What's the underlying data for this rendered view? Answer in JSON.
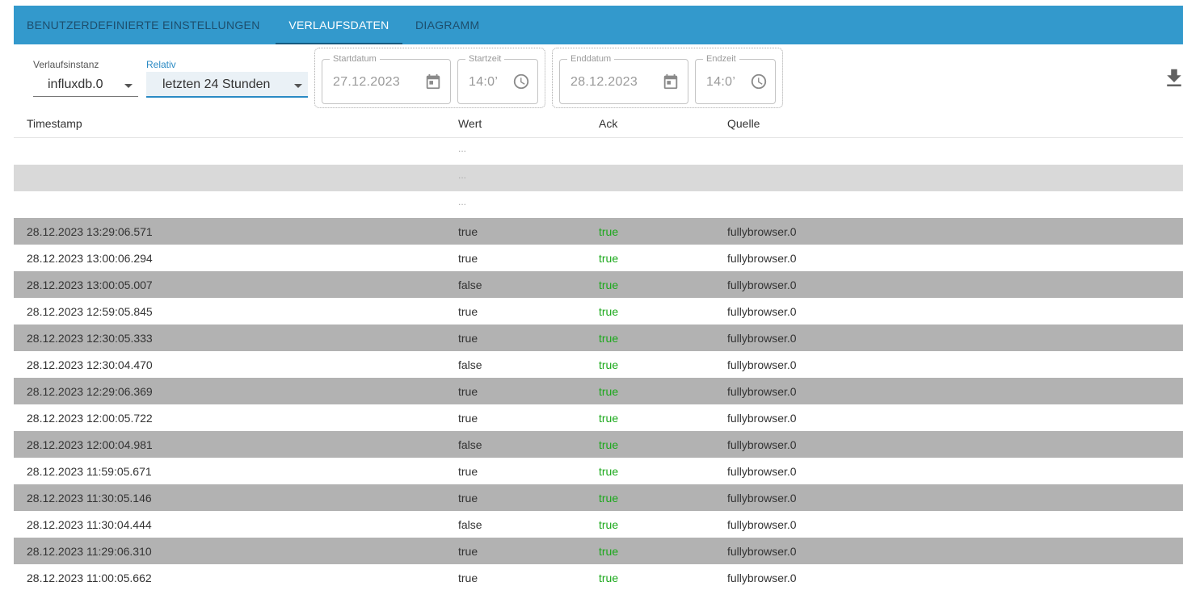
{
  "tabs": [
    {
      "label": "BENUTZERDEFINIERTE EINSTELLUNGEN"
    },
    {
      "label": "VERLAUFSDATEN"
    },
    {
      "label": "DIAGRAMM"
    }
  ],
  "controls": {
    "instance": {
      "label": "Verlaufsinstanz",
      "value": "influxdb.0"
    },
    "relative": {
      "label": "Relativ",
      "value": "letzten 24 Stunden"
    },
    "start_date": {
      "label": "Startdatum",
      "value": "27.12.2023"
    },
    "start_time": {
      "label": "Startzeit",
      "value": "14:0’"
    },
    "end_date": {
      "label": "Enddatum",
      "value": "28.12.2023"
    },
    "end_time": {
      "label": "Endzeit",
      "value": "14:0’"
    }
  },
  "table": {
    "headers": [
      "Timestamp",
      "Wert",
      "Ack",
      "Quelle"
    ],
    "placeholder_rows": [
      "...",
      "...",
      "..."
    ],
    "rows": [
      {
        "ts": "28.12.2023 13:29:06.571",
        "val": "true",
        "ack": "true",
        "src": "fullybrowser.0"
      },
      {
        "ts": "28.12.2023 13:00:06.294",
        "val": "true",
        "ack": "true",
        "src": "fullybrowser.0"
      },
      {
        "ts": "28.12.2023 13:00:05.007",
        "val": "false",
        "ack": "true",
        "src": "fullybrowser.0"
      },
      {
        "ts": "28.12.2023 12:59:05.845",
        "val": "true",
        "ack": "true",
        "src": "fullybrowser.0"
      },
      {
        "ts": "28.12.2023 12:30:05.333",
        "val": "true",
        "ack": "true",
        "src": "fullybrowser.0"
      },
      {
        "ts": "28.12.2023 12:30:04.470",
        "val": "false",
        "ack": "true",
        "src": "fullybrowser.0"
      },
      {
        "ts": "28.12.2023 12:29:06.369",
        "val": "true",
        "ack": "true",
        "src": "fullybrowser.0"
      },
      {
        "ts": "28.12.2023 12:00:05.722",
        "val": "true",
        "ack": "true",
        "src": "fullybrowser.0"
      },
      {
        "ts": "28.12.2023 12:00:04.981",
        "val": "false",
        "ack": "true",
        "src": "fullybrowser.0"
      },
      {
        "ts": "28.12.2023 11:59:05.671",
        "val": "true",
        "ack": "true",
        "src": "fullybrowser.0"
      },
      {
        "ts": "28.12.2023 11:30:05.146",
        "val": "true",
        "ack": "true",
        "src": "fullybrowser.0"
      },
      {
        "ts": "28.12.2023 11:30:04.444",
        "val": "false",
        "ack": "true",
        "src": "fullybrowser.0"
      },
      {
        "ts": "28.12.2023 11:29:06.310",
        "val": "true",
        "ack": "true",
        "src": "fullybrowser.0"
      },
      {
        "ts": "28.12.2023 11:00:05.662",
        "val": "true",
        "ack": "true",
        "src": "fullybrowser.0"
      }
    ]
  },
  "icons": {
    "calendar": "calendar-icon",
    "clock": "clock-icon",
    "download": "download-icon",
    "dropdown": "chevron-down-icon"
  },
  "colors": {
    "tabbar": "#3399cc",
    "active_tab_text": "#ffffff",
    "ack_true": "#1aa81a",
    "row_gray": "#b2b2b2"
  }
}
